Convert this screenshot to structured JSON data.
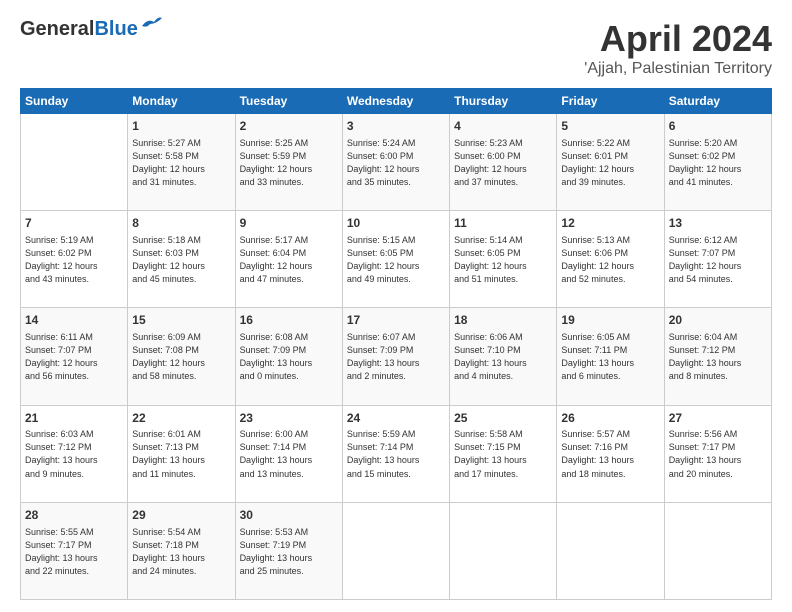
{
  "header": {
    "logo_general": "General",
    "logo_blue": "Blue",
    "main_title": "April 2024",
    "sub_title": "'Ajjah, Palestinian Territory"
  },
  "days_of_week": [
    "Sunday",
    "Monday",
    "Tuesday",
    "Wednesday",
    "Thursday",
    "Friday",
    "Saturday"
  ],
  "weeks": [
    [
      {
        "day": "",
        "info": ""
      },
      {
        "day": "1",
        "info": "Sunrise: 5:27 AM\nSunset: 5:58 PM\nDaylight: 12 hours\nand 31 minutes."
      },
      {
        "day": "2",
        "info": "Sunrise: 5:25 AM\nSunset: 5:59 PM\nDaylight: 12 hours\nand 33 minutes."
      },
      {
        "day": "3",
        "info": "Sunrise: 5:24 AM\nSunset: 6:00 PM\nDaylight: 12 hours\nand 35 minutes."
      },
      {
        "day": "4",
        "info": "Sunrise: 5:23 AM\nSunset: 6:00 PM\nDaylight: 12 hours\nand 37 minutes."
      },
      {
        "day": "5",
        "info": "Sunrise: 5:22 AM\nSunset: 6:01 PM\nDaylight: 12 hours\nand 39 minutes."
      },
      {
        "day": "6",
        "info": "Sunrise: 5:20 AM\nSunset: 6:02 PM\nDaylight: 12 hours\nand 41 minutes."
      }
    ],
    [
      {
        "day": "7",
        "info": "Sunrise: 5:19 AM\nSunset: 6:02 PM\nDaylight: 12 hours\nand 43 minutes."
      },
      {
        "day": "8",
        "info": "Sunrise: 5:18 AM\nSunset: 6:03 PM\nDaylight: 12 hours\nand 45 minutes."
      },
      {
        "day": "9",
        "info": "Sunrise: 5:17 AM\nSunset: 6:04 PM\nDaylight: 12 hours\nand 47 minutes."
      },
      {
        "day": "10",
        "info": "Sunrise: 5:15 AM\nSunset: 6:05 PM\nDaylight: 12 hours\nand 49 minutes."
      },
      {
        "day": "11",
        "info": "Sunrise: 5:14 AM\nSunset: 6:05 PM\nDaylight: 12 hours\nand 51 minutes."
      },
      {
        "day": "12",
        "info": "Sunrise: 5:13 AM\nSunset: 6:06 PM\nDaylight: 12 hours\nand 52 minutes."
      },
      {
        "day": "13",
        "info": "Sunrise: 6:12 AM\nSunset: 7:07 PM\nDaylight: 12 hours\nand 54 minutes."
      }
    ],
    [
      {
        "day": "14",
        "info": "Sunrise: 6:11 AM\nSunset: 7:07 PM\nDaylight: 12 hours\nand 56 minutes."
      },
      {
        "day": "15",
        "info": "Sunrise: 6:09 AM\nSunset: 7:08 PM\nDaylight: 12 hours\nand 58 minutes."
      },
      {
        "day": "16",
        "info": "Sunrise: 6:08 AM\nSunset: 7:09 PM\nDaylight: 13 hours\nand 0 minutes."
      },
      {
        "day": "17",
        "info": "Sunrise: 6:07 AM\nSunset: 7:09 PM\nDaylight: 13 hours\nand 2 minutes."
      },
      {
        "day": "18",
        "info": "Sunrise: 6:06 AM\nSunset: 7:10 PM\nDaylight: 13 hours\nand 4 minutes."
      },
      {
        "day": "19",
        "info": "Sunrise: 6:05 AM\nSunset: 7:11 PM\nDaylight: 13 hours\nand 6 minutes."
      },
      {
        "day": "20",
        "info": "Sunrise: 6:04 AM\nSunset: 7:12 PM\nDaylight: 13 hours\nand 8 minutes."
      }
    ],
    [
      {
        "day": "21",
        "info": "Sunrise: 6:03 AM\nSunset: 7:12 PM\nDaylight: 13 hours\nand 9 minutes."
      },
      {
        "day": "22",
        "info": "Sunrise: 6:01 AM\nSunset: 7:13 PM\nDaylight: 13 hours\nand 11 minutes."
      },
      {
        "day": "23",
        "info": "Sunrise: 6:00 AM\nSunset: 7:14 PM\nDaylight: 13 hours\nand 13 minutes."
      },
      {
        "day": "24",
        "info": "Sunrise: 5:59 AM\nSunset: 7:14 PM\nDaylight: 13 hours\nand 15 minutes."
      },
      {
        "day": "25",
        "info": "Sunrise: 5:58 AM\nSunset: 7:15 PM\nDaylight: 13 hours\nand 17 minutes."
      },
      {
        "day": "26",
        "info": "Sunrise: 5:57 AM\nSunset: 7:16 PM\nDaylight: 13 hours\nand 18 minutes."
      },
      {
        "day": "27",
        "info": "Sunrise: 5:56 AM\nSunset: 7:17 PM\nDaylight: 13 hours\nand 20 minutes."
      }
    ],
    [
      {
        "day": "28",
        "info": "Sunrise: 5:55 AM\nSunset: 7:17 PM\nDaylight: 13 hours\nand 22 minutes."
      },
      {
        "day": "29",
        "info": "Sunrise: 5:54 AM\nSunset: 7:18 PM\nDaylight: 13 hours\nand 24 minutes."
      },
      {
        "day": "30",
        "info": "Sunrise: 5:53 AM\nSunset: 7:19 PM\nDaylight: 13 hours\nand 25 minutes."
      },
      {
        "day": "",
        "info": ""
      },
      {
        "day": "",
        "info": ""
      },
      {
        "day": "",
        "info": ""
      },
      {
        "day": "",
        "info": ""
      }
    ]
  ]
}
